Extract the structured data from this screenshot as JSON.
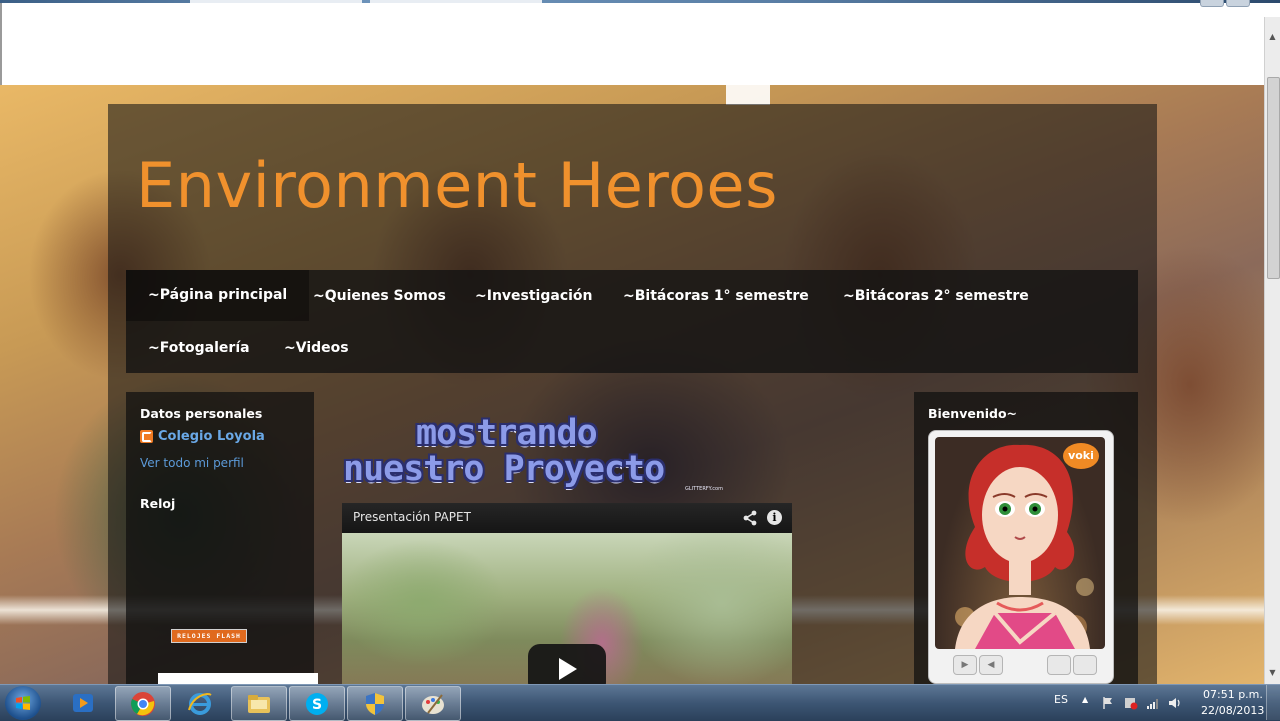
{
  "blog": {
    "title": "Environment Heroes"
  },
  "nav": {
    "items": [
      {
        "label": "~Página principal"
      },
      {
        "label": "~Quienes Somos"
      },
      {
        "label": "~Investigación"
      },
      {
        "label": "~Bitácoras 1° semestre"
      },
      {
        "label": "~Bitácoras 2° semestre"
      },
      {
        "label": "~Fotogalería"
      },
      {
        "label": "~Videos"
      }
    ]
  },
  "left_sidebar": {
    "profile": {
      "title": "Datos personales",
      "name": "Colegio Loyola",
      "view_profile": "Ver todo mi perfil"
    },
    "clock": {
      "title": "Reloj",
      "badge": "RELOJES FLASH"
    }
  },
  "main": {
    "banner": {
      "line1": "mostrando",
      "line2": "nuestro Proyecto",
      "watermark": "GLITTERFY.com"
    },
    "video": {
      "title": "Presentación PAPET"
    }
  },
  "right_sidebar": {
    "welcome_title": "Bienvenido~",
    "voki_logo": "voki"
  },
  "taskbar": {
    "language": "ES",
    "time": "07:51 p.m.",
    "date": "22/08/2013"
  },
  "colors": {
    "title": "#f0912d",
    "link": "#6aa8e6",
    "blogger": "#f07a22"
  }
}
